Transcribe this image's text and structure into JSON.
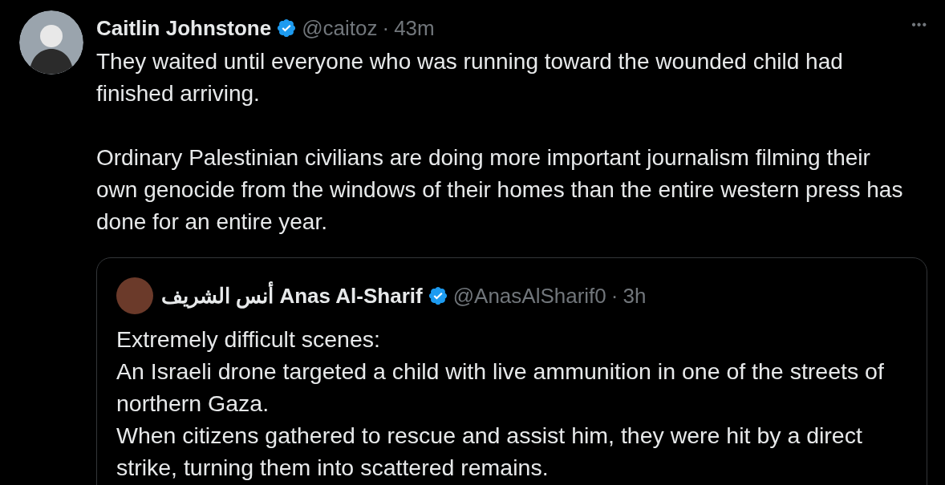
{
  "post": {
    "author": {
      "name": "Caitlin Johnstone",
      "verified": true,
      "handle": "@caitoz",
      "separator": "·",
      "time": "43m"
    },
    "more": "•••",
    "paragraphs": [
      "They waited until everyone who was running toward the wounded child had finished arriving.",
      "Ordinary Palestinian civilians are doing more important journalism filming their own genocide from the windows of their homes than the entire western press has done for an entire year."
    ],
    "quote": {
      "author": {
        "name": "أنس الشريف Anas Al-Sharif",
        "verified": true,
        "handle": "@AnasAlSharif0",
        "separator": "·",
        "time": "3h"
      },
      "lines": [
        "Extremely difficult scenes:",
        "An Israeli drone targeted a child with live ammunition in one of the streets of northern Gaza.",
        "When citizens gathered to rescue and assist him, they were hit by a direct strike, turning them into scattered remains."
      ]
    }
  }
}
